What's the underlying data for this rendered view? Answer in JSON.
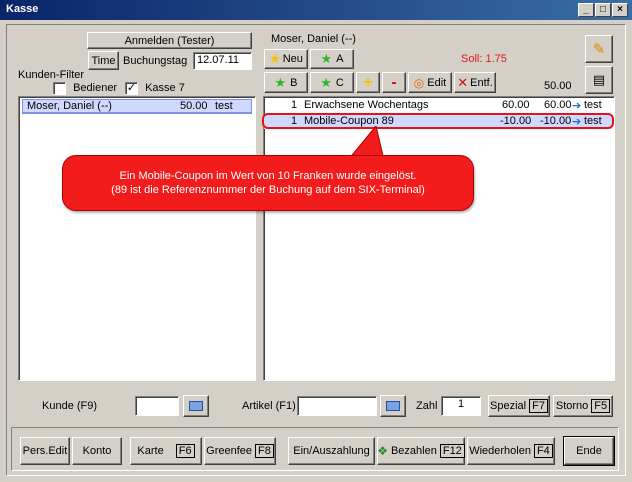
{
  "window": {
    "title": "Kasse"
  },
  "colors": {
    "soll": "#e31818",
    "callout": "#f21c1c",
    "selection": "#cfd8ff"
  },
  "left": {
    "login_button": "Anmelden (Tester)",
    "time_button": "Time",
    "booking_day_label": "Buchungstag",
    "booking_day_value": "12.07.11",
    "customer_filter_label": "Kunden-Filter",
    "filter_bediener_label": "Bediener",
    "filter_bediener_checked": false,
    "filter_kasse_label": "Kasse 7",
    "filter_kasse_checked": true,
    "customers": [
      {
        "name": "Moser, Daniel (--)",
        "amount": "50.00",
        "user": "test"
      }
    ]
  },
  "right": {
    "customer_name": "Moser, Daniel (--)",
    "soll": "Soll: 1.75",
    "total": "50.00",
    "buttons": {
      "neu": "Neu",
      "a": "A",
      "b": "B",
      "c": "C",
      "plus": "+",
      "minus": "-",
      "edit": "Edit",
      "entf": "Entf."
    },
    "items": [
      {
        "qty": "1",
        "desc": "Erwachsene Wochentags",
        "price": "60.00",
        "total": "60.00",
        "user": "test"
      },
      {
        "qty": "1",
        "desc": "Mobile-Coupon 89",
        "price": "-10.00",
        "total": "-10.00",
        "user": "test"
      }
    ]
  },
  "callout": {
    "line1": "Ein Mobile-Coupon im Wert von 10 Franken wurde eingelöst.",
    "line2": "(89 ist die Referenznummer der Buchung auf dem SIX-Terminal)"
  },
  "search": {
    "kunde_label": "Kunde (F9)",
    "artikel_label": "Artikel (F1)",
    "zahl_label": "Zahl",
    "zahl_value": "1",
    "spezial_label": "Spezial",
    "spezial_key": "F7",
    "storno_label": "Storno",
    "storno_key": "F5"
  },
  "bottom": {
    "pers_edit": "Pers.Edit",
    "konto": "Konto",
    "karte": "Karte",
    "karte_key": "F6",
    "greenfee": "Greenfee",
    "greenfee_key": "F8",
    "ein_auszahlung": "Ein/Auszahlung",
    "bezahlen": "Bezahlen",
    "bezahlen_key": "F12",
    "wiederholen": "Wiederholen",
    "wiederholen_key": "F4",
    "ende": "Ende"
  }
}
